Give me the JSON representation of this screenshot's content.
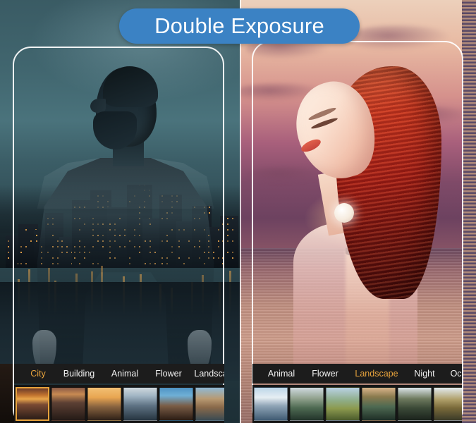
{
  "title": {
    "text": "Double Exposure",
    "pill_color": "#3b82c4"
  },
  "accent_color": "#e8a33c",
  "left_panel": {
    "name": "double-exposure-preview-man-city",
    "categories": [
      {
        "label": "City",
        "active": true
      },
      {
        "label": "Building",
        "active": false
      },
      {
        "label": "Animal",
        "active": false
      },
      {
        "label": "Flower",
        "active": false
      },
      {
        "label": "Landscape",
        "active": false
      }
    ],
    "thumbnails": [
      {
        "name": "city-sunset-skyline",
        "selected": true
      },
      {
        "name": "city-dusk-panorama",
        "selected": false
      },
      {
        "name": "city-golden-tower",
        "selected": false
      },
      {
        "name": "city-daylight-harbor",
        "selected": false
      },
      {
        "name": "city-blue-sky-downtown",
        "selected": false
      },
      {
        "name": "coastal-cliff-town",
        "selected": false
      }
    ]
  },
  "right_panel": {
    "name": "double-exposure-preview-woman-sunset",
    "categories": [
      {
        "label": "Animal",
        "active": false
      },
      {
        "label": "Flower",
        "active": false
      },
      {
        "label": "Landscape",
        "active": true
      },
      {
        "label": "Night",
        "active": false
      },
      {
        "label": "Ocean",
        "active": false
      }
    ],
    "thumbnails": [
      {
        "name": "snow-mountain-range",
        "selected": false
      },
      {
        "name": "alpine-lake-valley",
        "selected": false
      },
      {
        "name": "green-meadow-peak",
        "selected": false
      },
      {
        "name": "canyon-reflection-lake",
        "selected": false
      },
      {
        "name": "pine-forest-cabin",
        "selected": false
      },
      {
        "name": "autumn-mountain-river",
        "selected": false
      }
    ]
  }
}
